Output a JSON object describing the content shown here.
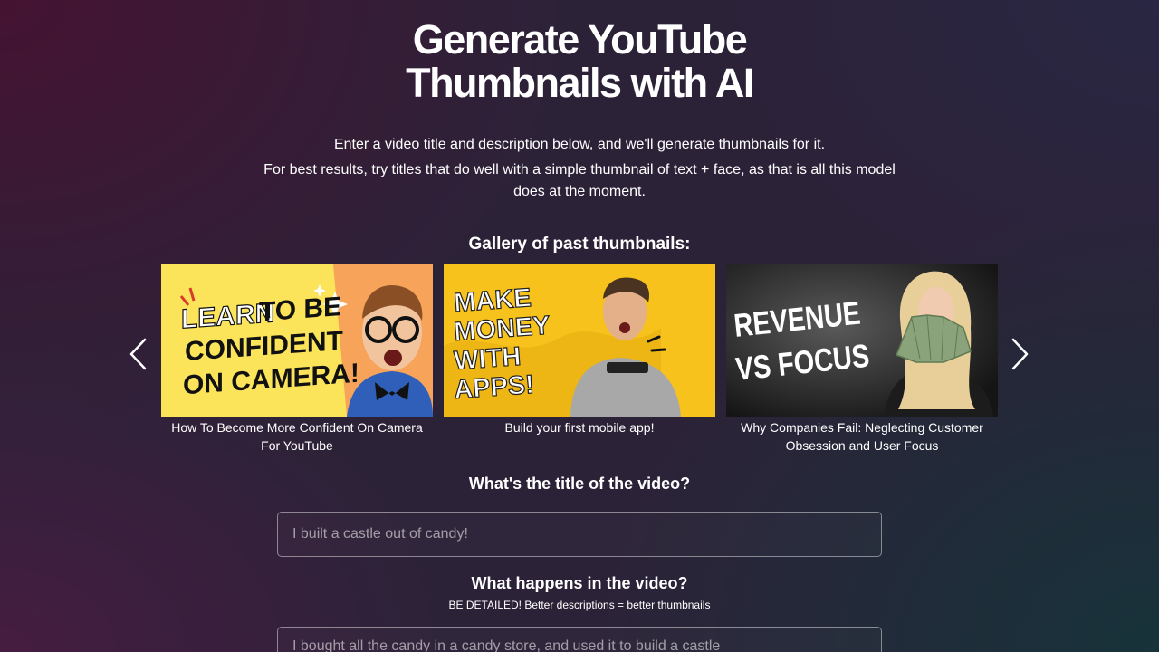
{
  "header": {
    "title_line1": "Generate YouTube",
    "title_line2": "Thumbnails with AI",
    "intro_line1": "Enter a video title and description below, and we'll generate thumbnails for it.",
    "intro_line2": "For best results, try titles that do well with a simple thumbnail of text + face, as that is all this model does at the moment."
  },
  "gallery": {
    "heading": "Gallery of past thumbnails:",
    "items": [
      {
        "caption": "How To Become More Confident On Camera For YouTube",
        "art_text_1": "LEARN",
        "art_text_2": "TO BE",
        "art_text_3": "CONFIDENT",
        "art_text_4": "ON CAMERA!"
      },
      {
        "caption": "Build your first mobile app!",
        "art_text_1": "MAKE",
        "art_text_2": "MONEY",
        "art_text_3": "WITH",
        "art_text_4": "APPS!"
      },
      {
        "caption": "Why Companies Fail: Neglecting Customer Obsession and User Focus",
        "art_text_1": "REVENUE",
        "art_text_2": "VS FOCUS"
      }
    ]
  },
  "form": {
    "title_label": "What's the title of the video?",
    "title_placeholder": "I built a castle out of candy!",
    "description_label": "What happens in the video?",
    "description_hint": "BE DETAILED! Better descriptions = better thumbnails",
    "description_placeholder": "I bought all the candy in a candy store, and used it to build a castle"
  },
  "colors": {
    "background": "#2c2238",
    "text": "#ffffff",
    "field_border": "#8c8894"
  },
  "icons": {
    "prev": "chevron-left-icon",
    "next": "chevron-right-icon"
  }
}
